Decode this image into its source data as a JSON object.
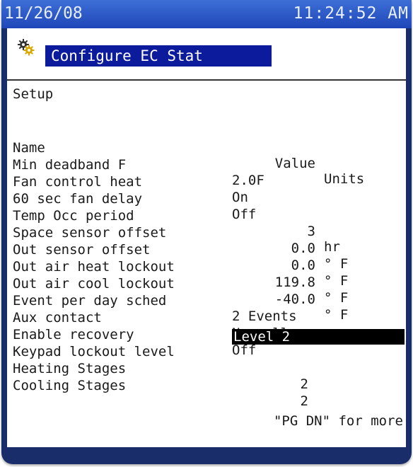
{
  "status": {
    "date": "11/26/08",
    "time": "11:24:52 AM"
  },
  "screen": {
    "title": "Configure EC Stat",
    "section": "Setup"
  },
  "columns": {
    "name": "Name",
    "value": "Value",
    "units": "Units"
  },
  "rows": [
    {
      "label": "Min deadband F",
      "value": "2.0F",
      "unit": ""
    },
    {
      "label": "Fan control heat",
      "value": "On",
      "unit": ""
    },
    {
      "label": "60 sec fan delay",
      "value": "Off",
      "unit": ""
    },
    {
      "label": "Temp Occ period",
      "value": "3",
      "unit": "hr"
    },
    {
      "label": "Space sensor offset",
      "value": "0.0",
      "unit": "° F"
    },
    {
      "label": "Out sensor offset",
      "value": "0.0",
      "unit": "° F"
    },
    {
      "label": "Out air heat lockout",
      "value": "119.8",
      "unit": "° F"
    },
    {
      "label": "Out air cool lockout",
      "value": "-40.0",
      "unit": "° F"
    },
    {
      "label": "Event per day sched",
      "value": "2 Events",
      "unit": ""
    },
    {
      "label": "Aux contact",
      "value": "Normally open",
      "unit": ""
    },
    {
      "label": "Enable recovery",
      "value": "Off",
      "unit": ""
    },
    {
      "label": "Keypad lockout level",
      "value": "Level 2",
      "unit": ""
    },
    {
      "label": "Heating Stages",
      "value": "2",
      "unit": ""
    },
    {
      "label": "Cooling Stages",
      "value": "2",
      "unit": ""
    }
  ],
  "footer": "\"PG DN\" for more",
  "colors": {
    "title_bar": "#1f46b8",
    "title_box": "#0c1a9c",
    "highlight": "#000000"
  },
  "icons": {
    "config": "gear-icon"
  }
}
